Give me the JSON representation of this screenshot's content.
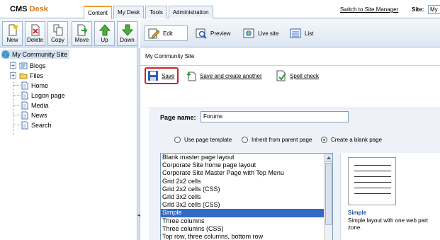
{
  "header": {
    "logo_cms": "CMS",
    "logo_desk": "Desk",
    "tabs": [
      {
        "label": "Content",
        "active": true
      },
      {
        "label": "My Desk",
        "active": false
      },
      {
        "label": "Tools",
        "active": false
      },
      {
        "label": "Administration",
        "active": false
      }
    ],
    "site_manager_link": "Switch to Site Manager",
    "site_label": "Site:",
    "site_value": "My"
  },
  "left_toolbar": {
    "buttons": [
      {
        "label": "New",
        "icon": "new-page-icon"
      },
      {
        "label": "Delete",
        "icon": "delete-icon"
      },
      {
        "label": "Copy",
        "icon": "copy-icon"
      },
      {
        "label": "Move",
        "icon": "move-icon"
      },
      {
        "label": "Up",
        "icon": "up-arrow-icon"
      },
      {
        "label": "Down",
        "icon": "down-arrow-icon"
      }
    ]
  },
  "view_toolbar": {
    "edit": "Edit",
    "preview": "Preview",
    "live_site": "Live site",
    "list": "List"
  },
  "tree": {
    "root": "My Community Site",
    "items": [
      {
        "label": "Blogs",
        "type": "folder",
        "expandable": true
      },
      {
        "label": "Files",
        "type": "folder",
        "expandable": true
      },
      {
        "label": "Home",
        "type": "page",
        "expandable": false
      },
      {
        "label": "Logon page",
        "type": "page",
        "expandable": false
      },
      {
        "label": "Media",
        "type": "page",
        "expandable": false
      },
      {
        "label": "News",
        "type": "page",
        "expandable": false
      },
      {
        "label": "Search",
        "type": "page",
        "expandable": false
      }
    ]
  },
  "content": {
    "breadcrumb": "My Community Site",
    "actions": {
      "save": "Save",
      "save_and_create": "Save and create another",
      "spell_check": "Spell check"
    },
    "page_name_label": "Page name:",
    "page_name_value": "Forums",
    "radio_options": [
      {
        "label": "Use page template",
        "checked": false
      },
      {
        "label": "Inherit from parent page",
        "checked": false
      },
      {
        "label": "Create a blank page",
        "checked": true
      }
    ],
    "layouts": [
      "Blank master page layout",
      "Corporate Site home page layout",
      "Corporate Site Master Page with Top Menu",
      "Grid 2x2 cells",
      "Grid 2x2 cells (CSS)",
      "Grid 3x2 cells",
      "Grid 3x2 cells (CSS)",
      "Simple",
      "Three columns",
      "Three columns (CSS)",
      "Top row, three columns, bottom row"
    ],
    "selected_layout": "Simple",
    "preview_title": "Simple",
    "preview_description": "Simple layout with one web part zone."
  },
  "colors": {
    "selection": "#3169c6",
    "save_highlight": "#d3232a",
    "link_blue": "#1d4fa0",
    "active_tab_accent": "#f0a030"
  }
}
